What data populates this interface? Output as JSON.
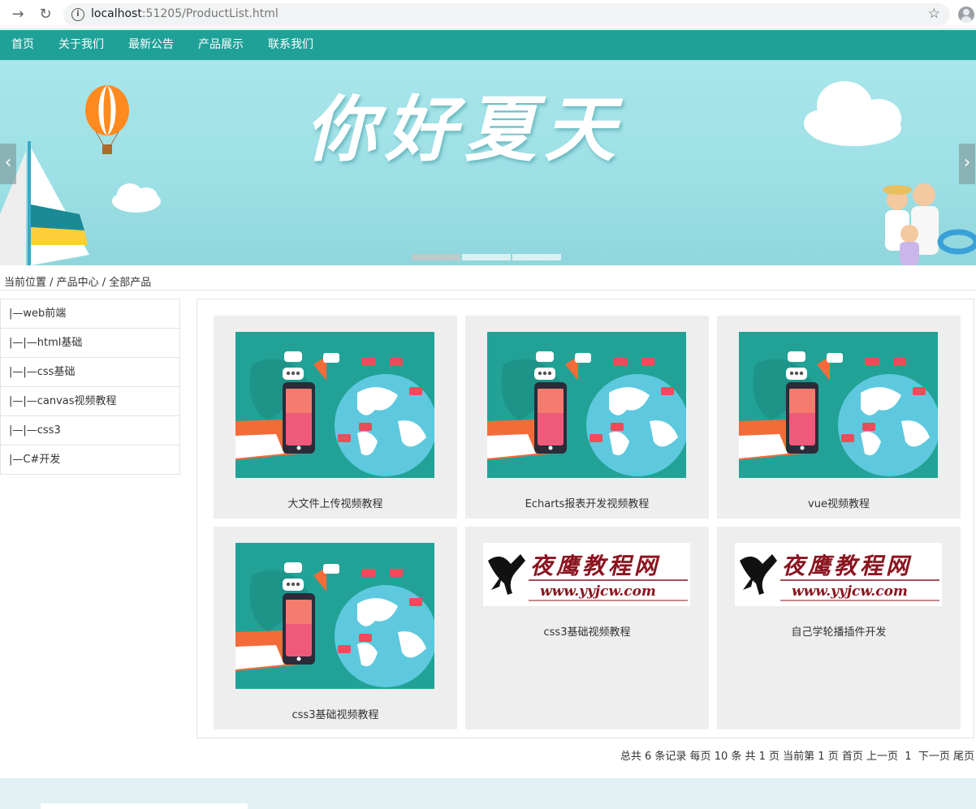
{
  "browser": {
    "url_host": "localhost",
    "url_rest": ":51205/ProductList.html"
  },
  "nav": [
    "首页",
    "关于我们",
    "最新公告",
    "产品展示",
    "联系我们"
  ],
  "banner": {
    "title": "你好夏天",
    "prev": "‹",
    "next": "›"
  },
  "breadcrumb": "当前位置 / 产品中心 / 全部产品",
  "sidebar": [
    "|—web前端",
    "|—|—html基础",
    "|—|—css基础",
    "|—|—canvas视频教程",
    "|—|—css3",
    "|—C#开发"
  ],
  "products": [
    {
      "title": "大文件上传视频教程",
      "image": "social-globe-illustration"
    },
    {
      "title": "Echarts报表开发视频教程",
      "image": "social-globe-illustration"
    },
    {
      "title": "vue视频教程",
      "image": "social-globe-illustration"
    },
    {
      "title": "css3基础视频教程",
      "image": "social-globe-illustration"
    },
    {
      "title": "css3基础视频教程",
      "image": "yyjcw-logo"
    },
    {
      "title": "自己学轮播插件开发",
      "image": "yyjcw-logo"
    }
  ],
  "logo": {
    "name": "夜鹰教程网",
    "site": "www.yyjcw.com"
  },
  "pager": {
    "text": "总共 6 条记录 每页 10 条 共 1 页 当前第 1 页",
    "first": "首页",
    "prev": "上一页",
    "page": "1",
    "next": "下一页",
    "last": "尾页"
  },
  "colors": {
    "nav_bg": "#1fa198",
    "card_bg": "#eeeeee",
    "banner_bg": "#a8e6ea"
  }
}
